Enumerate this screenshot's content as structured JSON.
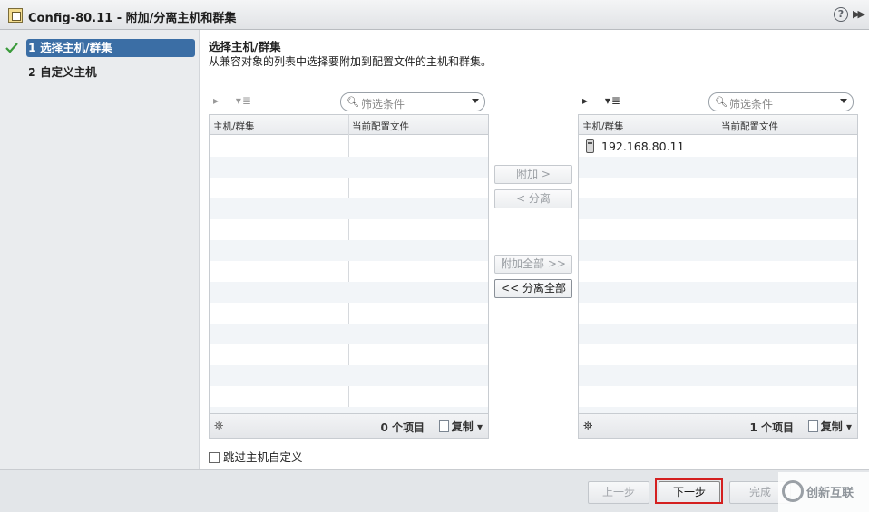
{
  "window": {
    "title": "Config-80.11 - 附加/分离主机和群集",
    "help": "?"
  },
  "nav": {
    "steps": [
      {
        "num": "1",
        "label": "选择主机/群集"
      },
      {
        "num": "2",
        "label": "自定义主机"
      }
    ]
  },
  "main": {
    "title": "选择主机/群集",
    "description": "从兼容对象的列表中选择要附加到配置文件的主机和群集。"
  },
  "left_panel": {
    "filter_placeholder": "筛选条件",
    "columns": [
      "主机/群集",
      "当前配置文件"
    ],
    "rows": [],
    "count": "0 个项目",
    "copy": "复制"
  },
  "right_panel": {
    "filter_placeholder": "筛选条件",
    "columns": [
      "主机/群集",
      "当前配置文件"
    ],
    "rows": [
      {
        "host": "192.168.80.11",
        "profile": ""
      }
    ],
    "count": "1 个项目",
    "copy": "复制"
  },
  "center_buttons": {
    "attach": "附加 >",
    "detach": "< 分离",
    "attach_all": "附加全部 >>",
    "detach_all": "<< 分离全部"
  },
  "skip_label": "跳过主机自定义",
  "footer": {
    "back": "上一步",
    "next": "下一步",
    "finish": "完成"
  },
  "watermark": {
    "text": "创新互联"
  },
  "colors": {
    "active_step": "#3b6ea5",
    "highlight": "#d42020",
    "check": "#3a9a3a"
  },
  "icons": {
    "check": "check-icon",
    "host": "host-icon",
    "search": "search-icon",
    "binoculars": "binoculars-icon",
    "copy": "copy-icon"
  }
}
